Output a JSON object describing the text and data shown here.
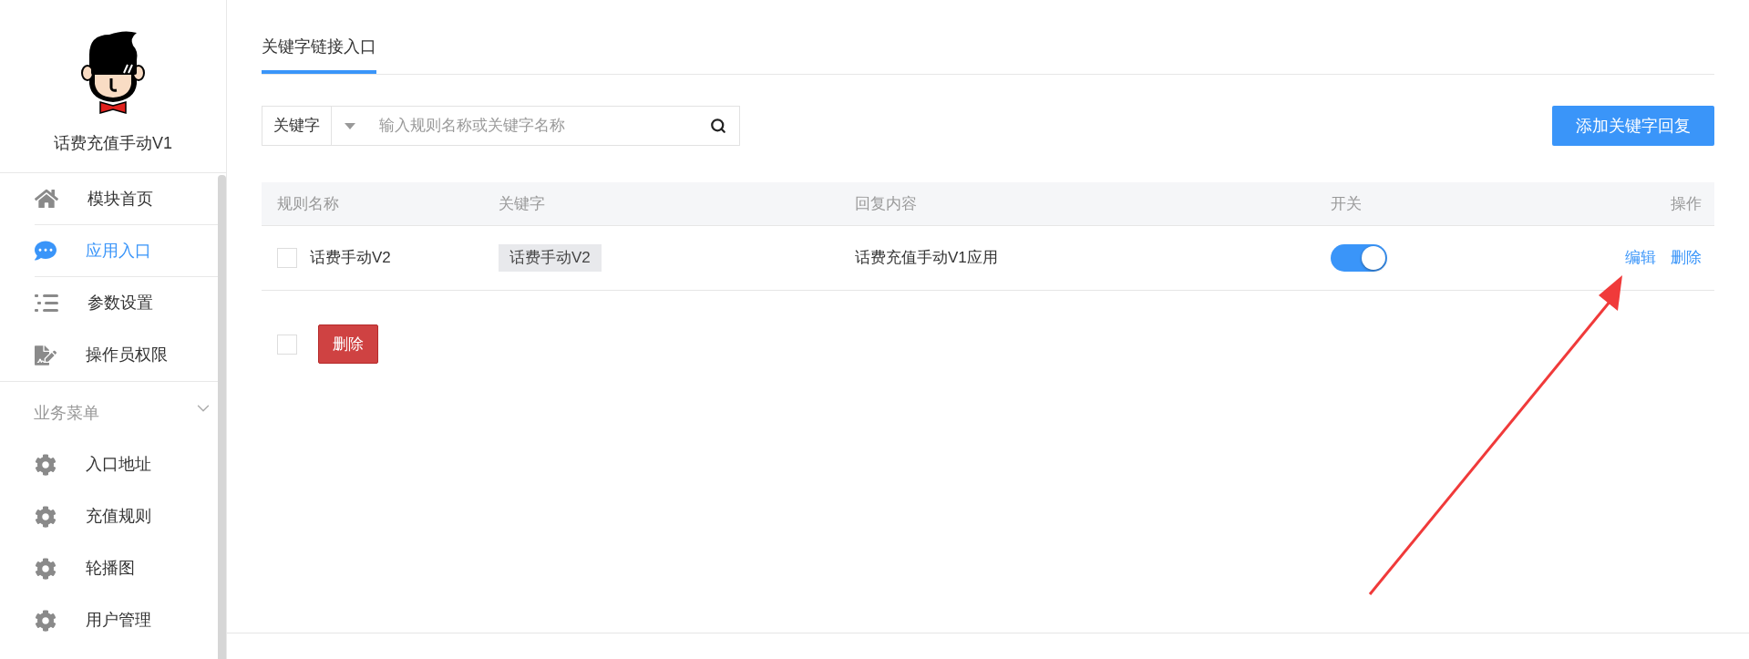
{
  "sidebar": {
    "app_name": "话费充值手动V1",
    "items": [
      {
        "label": "模块首页",
        "kind": "home",
        "selected": false
      },
      {
        "label": "应用入口",
        "kind": "chat",
        "selected": true
      },
      {
        "label": "参数设置",
        "kind": "list",
        "selected": false
      },
      {
        "label": "操作员权限",
        "kind": "doc",
        "selected": false
      }
    ],
    "section": {
      "label": "业务菜单",
      "expanded": true,
      "items": [
        {
          "label": "入口地址",
          "kind": "gear",
          "selected": false
        },
        {
          "label": "充值规则",
          "kind": "gear",
          "selected": false
        },
        {
          "label": "轮播图",
          "kind": "gear",
          "selected": false
        },
        {
          "label": "用户管理",
          "kind": "gear",
          "selected": false
        }
      ]
    }
  },
  "tabs": [
    {
      "label": "关键字链接入口",
      "selected": true
    }
  ],
  "search": {
    "filter": "关键字",
    "placeholder": "输入规则名称或关键字名称"
  },
  "add_button": "添加关键字回复",
  "table": {
    "columns": [
      "规则名称",
      "关键字",
      "回复内容",
      "开关",
      "操作"
    ],
    "rows": [
      {
        "checked": false,
        "name": "话费手动V2",
        "keyword": "话费手动V2",
        "reply": "话费充值手动V1应用",
        "on": true,
        "actions": [
          "编辑",
          "删除"
        ]
      }
    ]
  },
  "bulk": {
    "checked": false,
    "delete_button": "删除"
  }
}
